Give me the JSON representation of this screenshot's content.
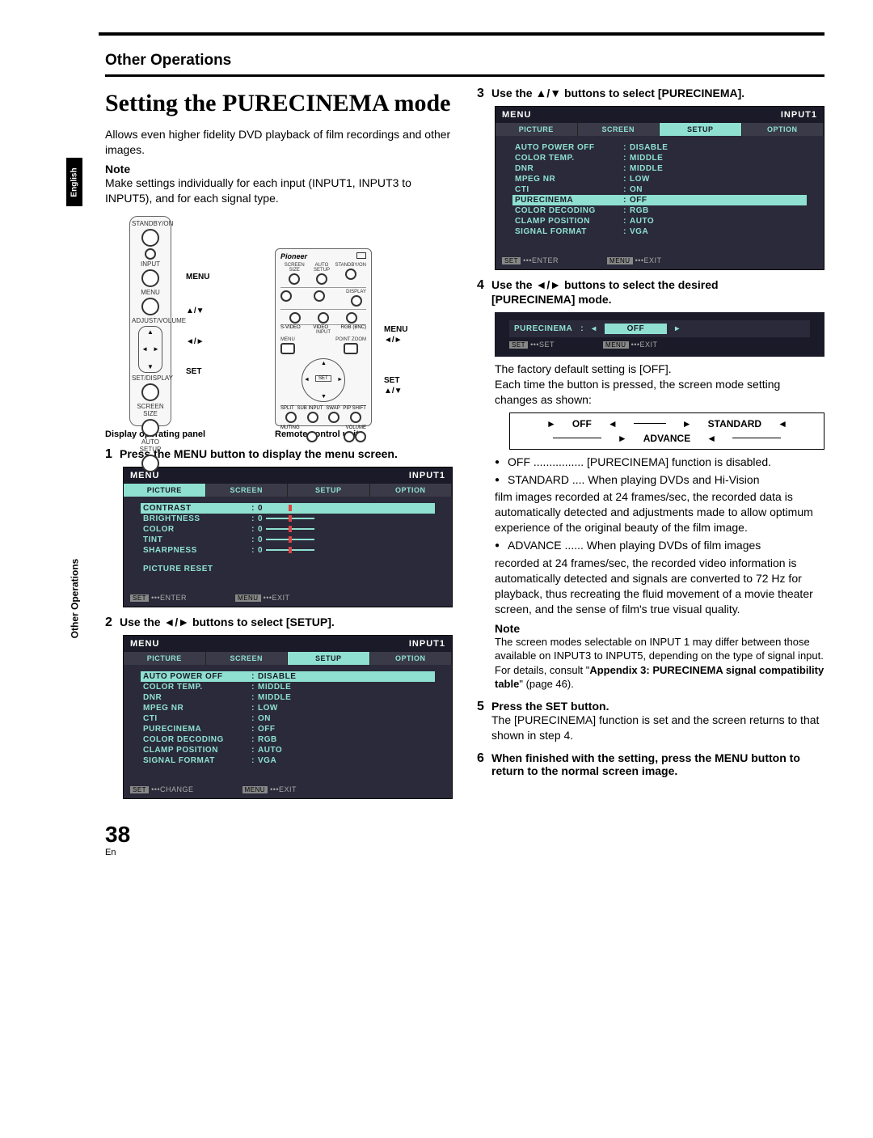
{
  "header": {
    "section": "Other Operations"
  },
  "tabs": {
    "english": "English",
    "other_ops_side": "Other Operations"
  },
  "title": "Setting the PURECINEMA mode",
  "intro": "Allows even higher fidelity DVD playback of film recordings and other images.",
  "note1_hd": "Note",
  "note1": "Make settings individually for each input (INPUT1, INPUT3 to INPUT5), and for each signal type.",
  "remote": {
    "cap_left": "Display operating panel",
    "cap_right": "Remote control unit",
    "lbl_standby": "STANDBY/ON",
    "lbl_input": "INPUT",
    "lbl_menu": "MENU",
    "lbl_adjvol": "ADJUST/VOLUME",
    "lbl_setdisp": "SET/DISPLAY",
    "lbl_scrsize": "SCREEN SIZE",
    "lbl_autoset": "AUTO SETUP",
    "call_menu": "MENU",
    "call_updown": "▲/▼",
    "call_leftright": "◄/►",
    "call_set": "SET",
    "brand": "Pioneer",
    "r2_standby": "STANDBY/ON",
    "r2_screen": "SCREEN SIZE",
    "r2_auto": "AUTO SETUP",
    "r2_display": "DISPLAY",
    "r2_svideo": "S-VIDEO",
    "r2_video": "VIDEO",
    "r2_rgb": "RGB (BNC)",
    "r2_inputrow": "INPUT",
    "r2_menu": "MENU",
    "r2_point": "POINT ZOOM",
    "r2_set": "SET",
    "r2_split": "SPLIT",
    "r2_sub": "SUB INPUT",
    "r2_swap": "SWAP",
    "r2_pip": "PIP SHIFT",
    "r2_muting": "MUTING",
    "r2_volume": "VOLUME"
  },
  "steps": {
    "s1": "Press the MENU button to display the menu screen.",
    "s2": "Use the ◄/► buttons to select [SETUP].",
    "s3": "Use the ▲/▼ buttons to select [PURECINEMA].",
    "s4a": "Use the ◄/► buttons to select the desired",
    "s4b": "[PURECINEMA] mode.",
    "s5hd": "Press the SET button.",
    "s5body": "The [PURECINEMA] function is set and the screen returns to that shown in step 4.",
    "s6": "When finished with the setting, press the MENU button to return to the normal screen image."
  },
  "osd": {
    "menu": "MENU",
    "input": "INPUT1",
    "tabs": [
      "PICTURE",
      "SCREEN",
      "SETUP",
      "OPTION"
    ],
    "picture_rows": [
      {
        "l": "CONTRAST",
        "v": "0"
      },
      {
        "l": "BRIGHTNESS",
        "v": "0"
      },
      {
        "l": "COLOR",
        "v": "0"
      },
      {
        "l": "TINT",
        "v": "0"
      },
      {
        "l": "SHARPNESS",
        "v": "0"
      }
    ],
    "picture_reset": "PICTURE RESET",
    "setup_rows": [
      {
        "l": "AUTO POWER OFF",
        "v": "DISABLE"
      },
      {
        "l": "COLOR TEMP.",
        "v": "MIDDLE"
      },
      {
        "l": "DNR",
        "v": "MIDDLE"
      },
      {
        "l": "MPEG NR",
        "v": "LOW"
      },
      {
        "l": "CTI",
        "v": "ON"
      },
      {
        "l": "PURECINEMA",
        "v": "OFF"
      },
      {
        "l": "COLOR DECODING",
        "v": "RGB"
      },
      {
        "l": "CLAMP POSITION",
        "v": "AUTO"
      },
      {
        "l": "SIGNAL FORMAT",
        "v": "VGA"
      }
    ],
    "foot_set": "SET",
    "foot_enter": "ENTER",
    "foot_change": "CHANGE",
    "foot_menu": "MENU",
    "foot_exit": "EXIT",
    "foot_set2": "SET",
    "lbl_purecinema": "PURECINEMA",
    "off": "OFF"
  },
  "right": {
    "factory": "The factory default setting is [OFF].",
    "eachtime": "Each time the button is pressed, the screen mode setting changes as shown:",
    "cycle": {
      "off": "OFF",
      "standard": "STANDARD",
      "advance": "ADVANCE"
    },
    "mode_off_l": "OFF ................",
    "mode_off_r": "[PURECINEMA] function is disabled.",
    "mode_std_l": "STANDARD ....",
    "mode_std_r1": "When playing DVDs and Hi-Vision",
    "mode_std_r2": "film images recorded at 24 frames/sec, the recorded data is automatically detected and adjustments made to allow optimum experience of the original beauty of the film image.",
    "mode_adv_l": "ADVANCE ......",
    "mode_adv_r1": "When playing DVDs of film images",
    "mode_adv_r2": "recorded at 24 frames/sec, the recorded video information is automatically detected and signals are converted to 72 Hz for playback, thus recreating the fluid movement of a movie theater screen, and the sense of film's true visual quality.",
    "note_hd": "Note",
    "note2a": "The screen modes selectable on INPUT 1 may differ between those available on INPUT3 to INPUT5, depending on the type of signal input. For details, consult \"",
    "note2b": "Appendix 3: PURECINEMA signal compatibility table",
    "note2c": "\" (page 46)."
  },
  "pagenum": "38",
  "pagenum_lang": "En"
}
